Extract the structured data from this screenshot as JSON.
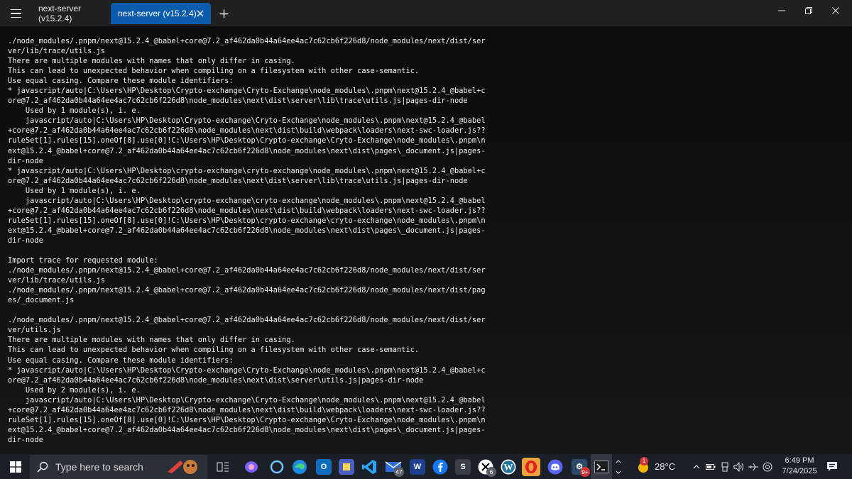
{
  "tabs": [
    {
      "label": "next-server (v15.2.4)",
      "active": false
    },
    {
      "label": "next-server (v15.2.4)",
      "active": true
    }
  ],
  "terminal_lines": [
    "./node_modules/.pnpm/next@15.2.4_@babel+core@7.2_af462da0b44a64ee4ac7c62cb6f226d8/node_modules/next/dist/ser",
    "ver/lib/trace/utils.js",
    "There are multiple modules with names that only differ in casing.",
    "This can lead to unexpected behavior when compiling on a filesystem with other case-semantic.",
    "Use equal casing. Compare these module identifiers:",
    "* javascript/auto|C:\\Users\\HP\\Desktop\\Crypto-exchange\\Cryto-Exchange\\node_modules\\.pnpm\\next@15.2.4_@babel+c",
    "ore@7.2_af462da0b44a64ee4ac7c62cb6f226d8\\node_modules\\next\\dist\\server\\lib\\trace\\utils.js|pages-dir-node",
    "    Used by 1 module(s), i. e.",
    "    javascript/auto|C:\\Users\\HP\\Desktop\\Crypto-exchange\\Cryto-Exchange\\node_modules\\.pnpm\\next@15.2.4_@babel",
    "+core@7.2_af462da0b44a64ee4ac7c62cb6f226d8\\node_modules\\next\\dist\\build\\webpack\\loaders\\next-swc-loader.js??",
    "ruleSet[1].rules[15].oneOf[8].use[0]!C:\\Users\\HP\\Desktop\\Crypto-exchange\\Cryto-Exchange\\node_modules\\.pnpm\\n",
    "ext@15.2.4_@babel+core@7.2_af462da0b44a64ee4ac7c62cb6f226d8\\node_modules\\next\\dist\\pages\\_document.js|pages-",
    "dir-node",
    "* javascript/auto|C:\\Users\\HP\\Desktop\\crypto-exchange\\cryto-exchange\\node_modules\\.pnpm\\next@15.2.4_@babel+c",
    "ore@7.2_af462da0b44a64ee4ac7c62cb6f226d8\\node_modules\\next\\dist\\server\\lib\\trace\\utils.js|pages-dir-node",
    "    Used by 1 module(s), i. e.",
    "    javascript/auto|C:\\Users\\HP\\Desktop\\crypto-exchange\\cryto-exchange\\node_modules\\.pnpm\\next@15.2.4_@babel",
    "+core@7.2_af462da0b44a64ee4ac7c62cb6f226d8\\node_modules\\next\\dist\\build\\webpack\\loaders\\next-swc-loader.js??",
    "ruleSet[1].rules[15].oneOf[8].use[0]!C:\\Users\\HP\\Desktop\\crypto-exchange\\cryto-exchange\\node_modules\\.pnpm\\n",
    "ext@15.2.4_@babel+core@7.2_af462da0b44a64ee4ac7c62cb6f226d8\\node_modules\\next\\dist\\pages\\_document.js|pages-",
    "dir-node",
    "",
    "Import trace for requested module:",
    "./node_modules/.pnpm/next@15.2.4_@babel+core@7.2_af462da0b44a64ee4ac7c62cb6f226d8/node_modules/next/dist/ser",
    "ver/lib/trace/utils.js",
    "./node_modules/.pnpm/next@15.2.4_@babel+core@7.2_af462da0b44a64ee4ac7c62cb6f226d8/node_modules/next/dist/pag",
    "es/_document.js",
    "",
    "./node_modules/.pnpm/next@15.2.4_@babel+core@7.2_af462da0b44a64ee4ac7c62cb6f226d8/node_modules/next/dist/ser",
    "ver/utils.js",
    "There are multiple modules with names that only differ in casing.",
    "This can lead to unexpected behavior when compiling on a filesystem with other case-semantic.",
    "Use equal casing. Compare these module identifiers:",
    "* javascript/auto|C:\\Users\\HP\\Desktop\\Crypto-exchange\\Cryto-Exchange\\node_modules\\.pnpm\\next@15.2.4_@babel+c",
    "ore@7.2_af462da0b44a64ee4ac7c62cb6f226d8\\node_modules\\next\\dist\\server\\utils.js|pages-dir-node",
    "    Used by 2 module(s), i. e.",
    "    javascript/auto|C:\\Users\\HP\\Desktop\\Crypto-exchange\\Cryto-Exchange\\node_modules\\.pnpm\\next@15.2.4_@babel",
    "+core@7.2_af462da0b44a64ee4ac7c62cb6f226d8\\node_modules\\next\\dist\\build\\webpack\\loaders\\next-swc-loader.js??",
    "ruleSet[1].rules[15].oneOf[8].use[0]!C:\\Users\\HP\\Desktop\\Crypto-exchange\\Cryto-Exchange\\node_modules\\.pnpm\\n",
    "ext@15.2.4_@babel+core@7.2_af462da0b44a64ee4ac7c62cb6f226d8\\node_modules\\next\\dist\\pages\\_document.js|pages-",
    "dir-node"
  ],
  "taskbar": {
    "search_placeholder": "Type here to search",
    "outlook_badge": "47",
    "x_badge": "6",
    "steam_badge": "9+",
    "weather_temp": "28°C",
    "weather_alert": "1",
    "time": "6:49 PM",
    "date": "7/24/2025",
    "app_icons": [
      "task-view-icon",
      "copilot-icon",
      "cortana-icon",
      "edge-icon",
      "outlook-icon",
      "stickies-icon",
      "vscode-icon",
      "mail-icon",
      "windscribe-icon",
      "facebook-icon",
      "s-app-icon",
      "x-icon",
      "wordpress-icon",
      "opera-icon",
      "discord-icon",
      "steam-icon",
      "terminal-icon"
    ]
  },
  "colors": {
    "tab_active": "#0b5cad",
    "titlebar": "#202020",
    "terminal_bg": "#0c0c0c",
    "terminal_text": "#f2f2f2",
    "taskbar": "#1b1f27"
  }
}
